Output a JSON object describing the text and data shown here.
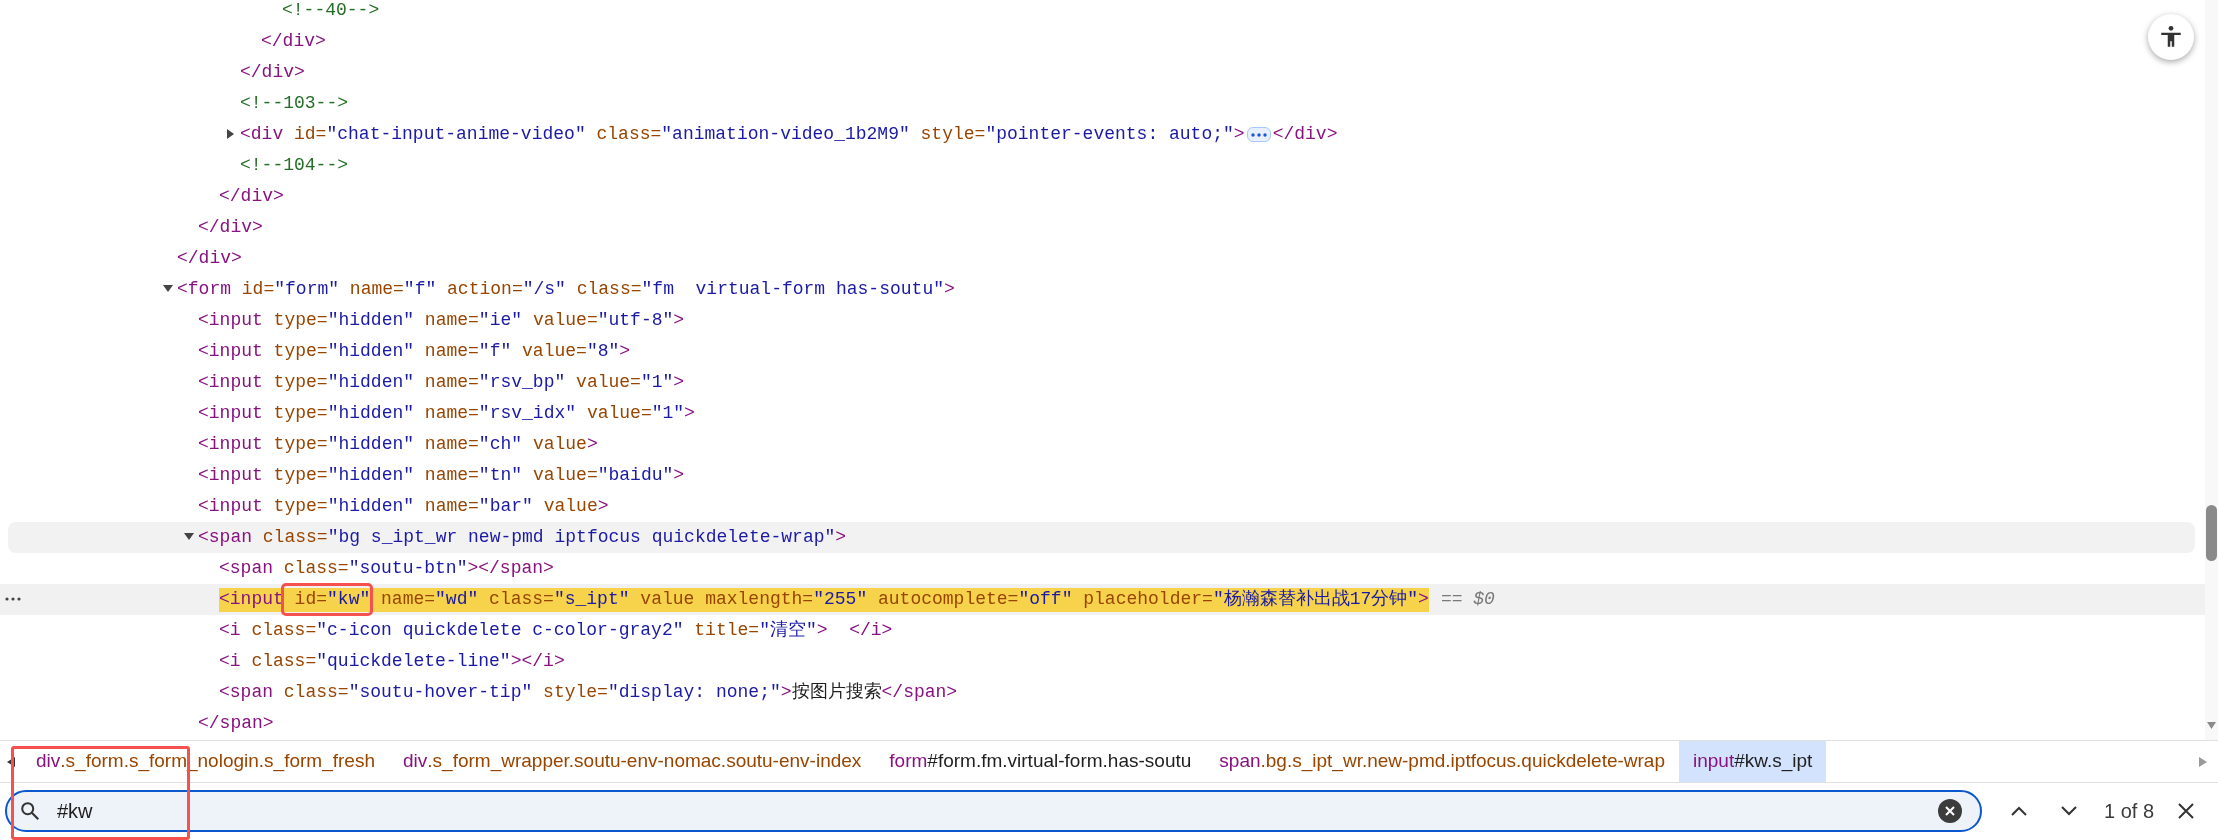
{
  "tree": [
    {
      "children": [
        {
          "children": [
            {
              "children": [
                {
                  "children": [
                    {
                      "children": [
                        {
                          "selected": false,
                          "hovered": false,
                          "tokens": [
                            {
                              "kind": "comment",
                              "text": "<!--40-->"
                            }
                          ]
                        }
                      ]
                    },
                    {
                      "selected": false,
                      "hovered": false,
                      "tokens": [
                        {
                          "kind": "tag",
                          "text": "</div>"
                        }
                      ]
                    }
                  ]
                },
                {
                  "selected": false,
                  "hovered": false,
                  "tokens": [
                    {
                      "kind": "tag",
                      "text": "</div>"
                    }
                  ]
                },
                {
                  "selected": false,
                  "hovered": false,
                  "tokens": [
                    {
                      "kind": "comment",
                      "text": "<!--103-->"
                    }
                  ]
                },
                {
                  "selected": false,
                  "hovered": false,
                  "expanded": false,
                  "tokens": [
                    {
                      "kind": "tag",
                      "text": "<div"
                    },
                    {
                      "kind": "attr",
                      "text": " id="
                    },
                    {
                      "kind": "value",
                      "text": "\"chat-input-anime-video\""
                    },
                    {
                      "kind": "attr",
                      "text": " class="
                    },
                    {
                      "kind": "value",
                      "text": "\"animation-video_1b2M9\""
                    },
                    {
                      "kind": "attr",
                      "text": " style="
                    },
                    {
                      "kind": "value",
                      "text": "\"pointer-events: auto;\""
                    },
                    {
                      "kind": "tag",
                      "text": ">"
                    },
                    {
                      "kind": "ellipsis"
                    },
                    {
                      "kind": "tag",
                      "text": "</div>"
                    }
                  ]
                },
                {
                  "selected": false,
                  "hovered": false,
                  "tokens": [
                    {
                      "kind": "comment",
                      "text": "<!--104-->"
                    }
                  ]
                }
              ]
            },
            {
              "selected": false,
              "hovered": false,
              "tokens": [
                {
                  "kind": "tag",
                  "text": "</div>"
                }
              ]
            }
          ]
        },
        {
          "selected": false,
          "hovered": false,
          "tokens": [
            {
              "kind": "tag",
              "text": "</div>"
            }
          ]
        }
      ]
    },
    {
      "selected": false,
      "hovered": false,
      "tokens": [
        {
          "kind": "tag",
          "text": "</div>"
        }
      ]
    },
    {
      "selected": false,
      "hovered": false,
      "expanded": true,
      "tokens": [
        {
          "kind": "tag",
          "text": "<form"
        },
        {
          "kind": "attr",
          "text": " id="
        },
        {
          "kind": "value",
          "text": "\"form\""
        },
        {
          "kind": "attr",
          "text": " name="
        },
        {
          "kind": "value",
          "text": "\"f\""
        },
        {
          "kind": "attr",
          "text": " action="
        },
        {
          "kind": "value",
          "text": "\"/s\""
        },
        {
          "kind": "attr",
          "text": " class="
        },
        {
          "kind": "value",
          "text": "\"fm  virtual-form has-soutu\""
        },
        {
          "kind": "tag",
          "text": ">"
        }
      ],
      "children": [
        {
          "selected": false,
          "hovered": false,
          "tokens": [
            {
              "kind": "tag",
              "text": "<input"
            },
            {
              "kind": "attr",
              "text": " type="
            },
            {
              "kind": "value",
              "text": "\"hidden\""
            },
            {
              "kind": "attr",
              "text": " name="
            },
            {
              "kind": "value",
              "text": "\"ie\""
            },
            {
              "kind": "attr",
              "text": " value="
            },
            {
              "kind": "value",
              "text": "\"utf-8\""
            },
            {
              "kind": "tag",
              "text": ">"
            }
          ]
        },
        {
          "selected": false,
          "hovered": false,
          "tokens": [
            {
              "kind": "tag",
              "text": "<input"
            },
            {
              "kind": "attr",
              "text": " type="
            },
            {
              "kind": "value",
              "text": "\"hidden\""
            },
            {
              "kind": "attr",
              "text": " name="
            },
            {
              "kind": "value",
              "text": "\"f\""
            },
            {
              "kind": "attr",
              "text": " value="
            },
            {
              "kind": "value",
              "text": "\"8\""
            },
            {
              "kind": "tag",
              "text": ">"
            }
          ]
        },
        {
          "selected": false,
          "hovered": false,
          "tokens": [
            {
              "kind": "tag",
              "text": "<input"
            },
            {
              "kind": "attr",
              "text": " type="
            },
            {
              "kind": "value",
              "text": "\"hidden\""
            },
            {
              "kind": "attr",
              "text": " name="
            },
            {
              "kind": "value",
              "text": "\"rsv_bp\""
            },
            {
              "kind": "attr",
              "text": " value="
            },
            {
              "kind": "value",
              "text": "\"1\""
            },
            {
              "kind": "tag",
              "text": ">"
            }
          ]
        },
        {
          "selected": false,
          "hovered": false,
          "tokens": [
            {
              "kind": "tag",
              "text": "<input"
            },
            {
              "kind": "attr",
              "text": " type="
            },
            {
              "kind": "value",
              "text": "\"hidden\""
            },
            {
              "kind": "attr",
              "text": " name="
            },
            {
              "kind": "value",
              "text": "\"rsv_idx\""
            },
            {
              "kind": "attr",
              "text": " value="
            },
            {
              "kind": "value",
              "text": "\"1\""
            },
            {
              "kind": "tag",
              "text": ">"
            }
          ]
        },
        {
          "selected": false,
          "hovered": false,
          "tokens": [
            {
              "kind": "tag",
              "text": "<input"
            },
            {
              "kind": "attr",
              "text": " type="
            },
            {
              "kind": "value",
              "text": "\"hidden\""
            },
            {
              "kind": "attr",
              "text": " name="
            },
            {
              "kind": "value",
              "text": "\"ch\""
            },
            {
              "kind": "attr",
              "text": " value"
            },
            {
              "kind": "tag",
              "text": ">"
            }
          ]
        },
        {
          "selected": false,
          "hovered": false,
          "tokens": [
            {
              "kind": "tag",
              "text": "<input"
            },
            {
              "kind": "attr",
              "text": " type="
            },
            {
              "kind": "value",
              "text": "\"hidden\""
            },
            {
              "kind": "attr",
              "text": " name="
            },
            {
              "kind": "value",
              "text": "\"tn\""
            },
            {
              "kind": "attr",
              "text": " value="
            },
            {
              "kind": "value",
              "text": "\"baidu\""
            },
            {
              "kind": "tag",
              "text": ">"
            }
          ]
        },
        {
          "selected": false,
          "hovered": false,
          "tokens": [
            {
              "kind": "tag",
              "text": "<input"
            },
            {
              "kind": "attr",
              "text": " type="
            },
            {
              "kind": "value",
              "text": "\"hidden\""
            },
            {
              "kind": "attr",
              "text": " name="
            },
            {
              "kind": "value",
              "text": "\"bar\""
            },
            {
              "kind": "attr",
              "text": " value"
            },
            {
              "kind": "tag",
              "text": ">"
            }
          ]
        },
        {
          "selected": false,
          "hovered": true,
          "expanded": true,
          "tokens": [
            {
              "kind": "tag",
              "text": "<span"
            },
            {
              "kind": "attr",
              "text": " class="
            },
            {
              "kind": "value",
              "text": "\"bg s_ipt_wr new-pmd iptfocus quickdelete-wrap\""
            },
            {
              "kind": "tag",
              "text": ">"
            }
          ],
          "children": [
            {
              "selected": false,
              "hovered": false,
              "tokens": [
                {
                  "kind": "tag",
                  "text": "<span"
                },
                {
                  "kind": "attr",
                  "text": " class="
                },
                {
                  "kind": "value",
                  "text": "\"soutu-btn\""
                },
                {
                  "kind": "tag",
                  "text": "></span>"
                }
              ]
            },
            {
              "selected": true,
              "hovered": false,
              "search_match": true,
              "console_ref": "== $0",
              "tokens": [
                {
                  "kind": "tag",
                  "text": "<input"
                },
                {
                  "kind": "boxed",
                  "tokens": [
                    {
                      "kind": "attr",
                      "text": " id="
                    },
                    {
                      "kind": "value",
                      "text": "\"kw\""
                    }
                  ]
                },
                {
                  "kind": "attr",
                  "text": " name="
                },
                {
                  "kind": "value",
                  "text": "\"wd\""
                },
                {
                  "kind": "attr",
                  "text": " class="
                },
                {
                  "kind": "value",
                  "text": "\"s_ipt\""
                },
                {
                  "kind": "attr",
                  "text": " value maxlength="
                },
                {
                  "kind": "value",
                  "text": "\"255\""
                },
                {
                  "kind": "attr",
                  "text": " autocomplete="
                },
                {
                  "kind": "value",
                  "text": "\"off\""
                },
                {
                  "kind": "attr",
                  "text": " placeholder="
                },
                {
                  "kind": "value",
                  "text": "\"杨瀚森替补出战17分钟\""
                },
                {
                  "kind": "tag",
                  "text": ">"
                }
              ]
            },
            {
              "selected": false,
              "hovered": false,
              "tokens": [
                {
                  "kind": "tag",
                  "text": "<i"
                },
                {
                  "kind": "attr",
                  "text": " class="
                },
                {
                  "kind": "value",
                  "text": "\"c-icon quickdelete c-color-gray2\""
                },
                {
                  "kind": "attr",
                  "text": " title="
                },
                {
                  "kind": "value",
                  "text": "\"清空\""
                },
                {
                  "kind": "tag",
                  "text": ">  </i>"
                }
              ]
            },
            {
              "selected": false,
              "hovered": false,
              "tokens": [
                {
                  "kind": "tag",
                  "text": "<i"
                },
                {
                  "kind": "attr",
                  "text": " class="
                },
                {
                  "kind": "value",
                  "text": "\"quickdelete-line\""
                },
                {
                  "kind": "tag",
                  "text": "></i>"
                }
              ]
            },
            {
              "selected": false,
              "hovered": false,
              "tokens": [
                {
                  "kind": "tag",
                  "text": "<span"
                },
                {
                  "kind": "attr",
                  "text": " class="
                },
                {
                  "kind": "value",
                  "text": "\"soutu-hover-tip\""
                },
                {
                  "kind": "attr",
                  "text": " style="
                },
                {
                  "kind": "value",
                  "text": "\"display: none;\""
                },
                {
                  "kind": "tag",
                  "text": ">"
                },
                {
                  "kind": "text",
                  "text": "按图片搜索"
                },
                {
                  "kind": "tag",
                  "text": "</span>"
                }
              ]
            }
          ]
        },
        {
          "selected": false,
          "hovered": false,
          "tokens": [
            {
              "kind": "tag",
              "text": "</span>"
            }
          ]
        }
      ]
    }
  ],
  "breadcrumbs": [
    {
      "selected": false,
      "tokens": [
        {
          "kind": "tag",
          "text": "div"
        },
        {
          "kind": "class",
          "text": ".s_form.s_form_nologin.s_form_fresh"
        }
      ]
    },
    {
      "selected": false,
      "tokens": [
        {
          "kind": "tag",
          "text": "div"
        },
        {
          "kind": "class",
          "text": ".s_form_wrapper.soutu-env-nomac.soutu-env-index"
        }
      ]
    },
    {
      "selected": false,
      "tokens": [
        {
          "kind": "tag",
          "text": "form"
        },
        {
          "kind": "text",
          "text": "#form.fm.virtual-form.has-soutu"
        }
      ]
    },
    {
      "selected": false,
      "tokens": [
        {
          "kind": "tag",
          "text": "span"
        },
        {
          "kind": "class",
          "text": ".bg.s_ipt_wr.new-pmd.iptfocus.quickdelete-wrap"
        }
      ]
    },
    {
      "selected": true,
      "tokens": [
        {
          "kind": "tag",
          "text": "input"
        },
        {
          "kind": "text",
          "text": "#kw.s_ipt"
        }
      ]
    }
  ],
  "search": {
    "value": "#kw",
    "match_count": "1 of 8",
    "marked": true
  }
}
